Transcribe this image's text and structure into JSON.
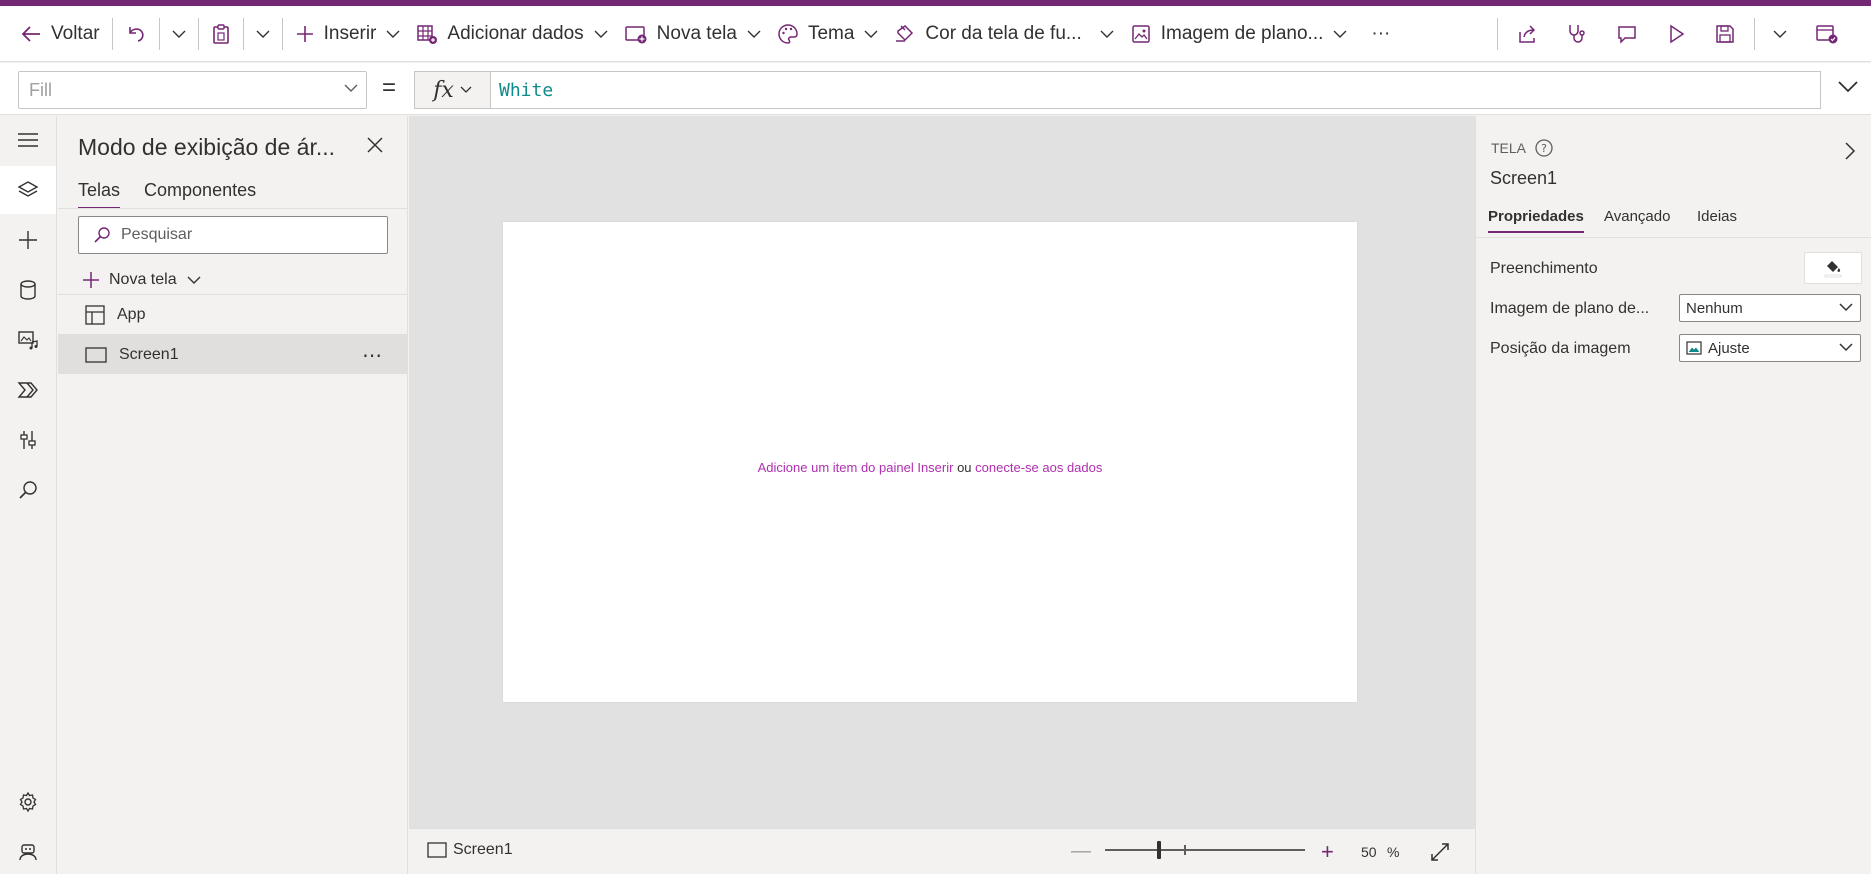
{
  "toolbar": {
    "back_label": "Voltar",
    "insert_label": "Inserir",
    "add_data_label": "Adicionar dados",
    "new_screen_label": "Nova tela",
    "theme_label": "Tema",
    "bg_color_label": "Cor da tela de fu...",
    "bg_image_label": "Imagem de plano...",
    "more_label": "···"
  },
  "formula_bar": {
    "property": "Fill",
    "equals": "=",
    "fx_label": "fx",
    "formula": "White"
  },
  "tree_view": {
    "title": "Modo de exibição de ár...",
    "tabs": [
      {
        "label": "Telas",
        "active": true
      },
      {
        "label": "Componentes",
        "active": false
      }
    ],
    "search_placeholder": "Pesquisar",
    "new_screen_label": "Nova tela",
    "items": [
      {
        "label": "App"
      },
      {
        "label": "Screen1",
        "selected": true,
        "more": "⋯"
      }
    ]
  },
  "canvas": {
    "hint_part1": "Adicione um item do painel Inserir",
    "hint_or": "ou",
    "hint_part2": "conecte-se aos dados"
  },
  "statusbar": {
    "screen_label": "Screen1",
    "zoom_minus": "—",
    "zoom_plus": "+",
    "zoom_value": "50",
    "zoom_unit": "%",
    "zoom_level": 0.26
  },
  "properties": {
    "type_label": "TELA",
    "help": "?",
    "name": "Screen1",
    "tabs": [
      {
        "label": "Propriedades",
        "active": true
      },
      {
        "label": "Avançado",
        "active": false
      },
      {
        "label": "Ideias",
        "active": false
      }
    ],
    "fill_label": "Preenchimento",
    "bg_image_label": "Imagem de plano de...",
    "bg_image_value": "Nenhum",
    "image_position_label": "Posição da imagem",
    "image_position_value": "Ajuste"
  },
  "colors": {
    "accent": "#742774",
    "link": "#b02fb0",
    "formula_text": "#0e8a8a"
  }
}
